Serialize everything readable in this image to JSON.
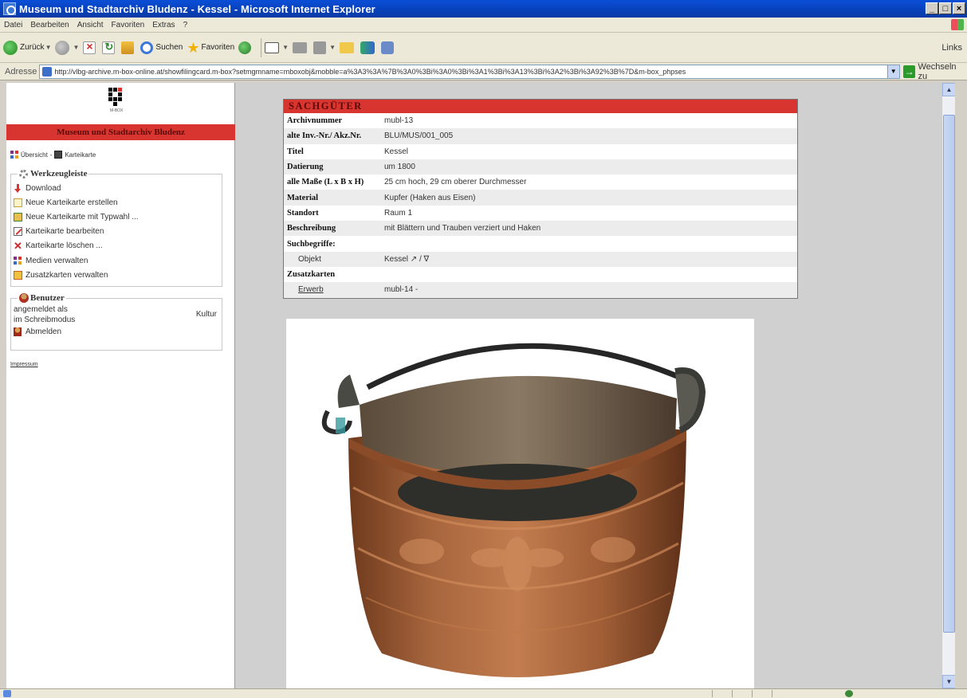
{
  "window": {
    "title": "Museum und Stadtarchiv Bludenz - Kessel - Microsoft Internet Explorer",
    "controls": [
      "_",
      "□",
      "×"
    ]
  },
  "menu": [
    "Datei",
    "Bearbeiten",
    "Ansicht",
    "Favoriten",
    "Extras",
    "?"
  ],
  "toolbar": {
    "back": "Zurück",
    "search": "Suchen",
    "favorites": "Favoriten",
    "links": "Links"
  },
  "address": {
    "label": "Adresse",
    "url": "http://vlbg-archive.m-box-online.at/showfilingcard.m-box?setmgmname=mboxobj&mobble=a%3A3%3A%7B%3A0%3Bi%3A0%3Bi%3A1%3Bi%3A13%3Bi%3A2%3Bi%3A92%3B%7D&m-box_phpses",
    "go": "Wechseln zu"
  },
  "sidebar": {
    "logo_label": "M-BOX",
    "org_name": "Museum und Stadtarchiv Bludenz",
    "breadcrumb": {
      "overview": "Übersicht",
      "separator": "-",
      "card": "Karteikarte"
    },
    "tools_title": "Werkzeugleiste",
    "tools": [
      "Download",
      "Neue Karteikarte erstellen",
      "Neue Karteikarte mit Typwahl ...",
      "Karteikarte bearbeiten",
      "Karteikarte löschen ...",
      "Medien verwalten",
      "Zusatzkarten verwalten"
    ],
    "user_title": "Benutzer",
    "user_line1": "angemeldet als",
    "user_role": "Kultur",
    "user_line2": "im Schreibmodus",
    "logout": "Abmelden",
    "impressum": "Impressum"
  },
  "card": {
    "header": "SACHGÜTER",
    "rows": [
      {
        "key": "Archivnummer",
        "value": "mubl-13"
      },
      {
        "key": "alte Inv.-Nr./ Akz.Nr.",
        "value": "BLU/MUS/001_005"
      },
      {
        "key": "Titel",
        "value": "Kessel"
      },
      {
        "key": "Datierung",
        "value": "um 1800"
      },
      {
        "key": "alle Maße (L x B x H)",
        "value": "25 cm hoch, 29 cm oberer Durchmesser"
      },
      {
        "key": "Material",
        "value": "Kupfer (Haken aus Eisen)"
      },
      {
        "key": "Standort",
        "value": "Raum 1"
      },
      {
        "key": "Beschreibung",
        "value": "mit Blättern und Trauben verziert und Haken"
      },
      {
        "key": "Suchbegriffe:",
        "value": ""
      },
      {
        "key": "Objekt",
        "value": "Kessel  ↗ / ∇"
      },
      {
        "key": "Zusatzkarten",
        "value": ""
      },
      {
        "key": "Erwerb",
        "value": "mubl-14 -"
      }
    ]
  },
  "photo": {
    "subject": "copper-kettle-photo",
    "colors": {
      "copper": "#a8663e",
      "copper_dark": "#6e3a1c",
      "interior": "#3a3a36",
      "handle": "#2a2a2a"
    }
  },
  "colors": {
    "accent_red": "#d83530",
    "title_blue": "#0a4fd8",
    "frame_gray": "#d0d0d0"
  }
}
